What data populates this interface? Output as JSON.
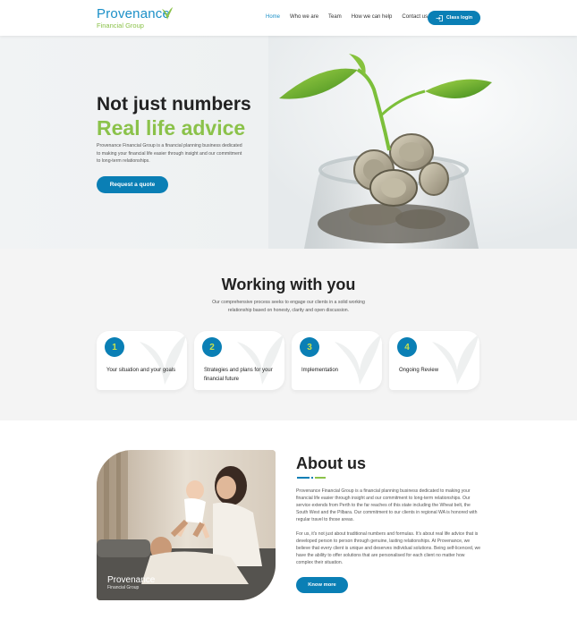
{
  "header": {
    "logo_name": "Provenance",
    "logo_sub": "Financial Group",
    "nav": [
      "Home",
      "Who we are",
      "Team",
      "How we can help",
      "Contact us"
    ],
    "login_label": "Class login"
  },
  "hero": {
    "title_line1": "Not just numbers",
    "title_line2": "Real life advice",
    "description": "Provenance Financial Group is a financial planning business dedicated to making your financial life easier through insight and our commitment to long-term relationships.",
    "cta": "Request a quote"
  },
  "working": {
    "title": "Working with you",
    "subtitle": "Our comprehensive process seeks to engage our clients in a solid working relationship based on honesty, clarity and open discussion.",
    "steps": [
      {
        "num": "1",
        "label": "Your situation and your goals"
      },
      {
        "num": "2",
        "label": "Strategies and plans for your financial future"
      },
      {
        "num": "3",
        "label": "Implementation"
      },
      {
        "num": "4",
        "label": "Ongoing Review"
      }
    ]
  },
  "about": {
    "title": "About us",
    "para1": "Provenance Financial Group is a financial planning business dedicated to making your financial life easier through insight and our commitment to long-term relationships. Our service extends from Perth to the far reaches of this state including the Wheat belt, the South West and the Pilbara. Our commitment to our clients in regional WA is honored with regular travel to those areas.",
    "para2": "For us, it's not just about traditional numbers and formulas. It's about real life advice that is developed person to person through genuine, lasting relationships. At Provenance, we believe that every client is unique and deserves individual solutions. Being self-licenced, we have the ability to offer solutions that are personalised for each client no matter how complex their situation.",
    "cta": "Know more",
    "photo_logo_name": "Provenance",
    "photo_logo_sub": "Financial Group"
  },
  "colors": {
    "primary": "#0a7fb5",
    "accent": "#8bc24a"
  }
}
